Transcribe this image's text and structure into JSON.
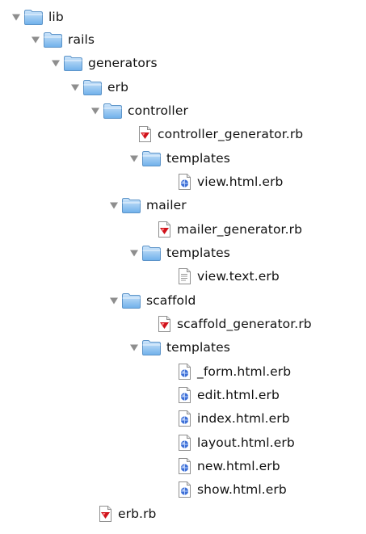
{
  "tree": {
    "nodes": [
      {
        "id": "lib",
        "label": "lib",
        "icon": "folder-icon",
        "kind": "folder",
        "expanded": true
      },
      {
        "id": "rails",
        "label": "rails",
        "icon": "folder-icon",
        "kind": "folder",
        "expanded": true
      },
      {
        "id": "generators",
        "label": "generators",
        "icon": "folder-icon",
        "kind": "folder",
        "expanded": true
      },
      {
        "id": "erb",
        "label": "erb",
        "icon": "folder-icon",
        "kind": "folder",
        "expanded": true
      },
      {
        "id": "controller",
        "label": "controller",
        "icon": "folder-icon",
        "kind": "folder",
        "expanded": true
      },
      {
        "id": "controller-generator-rb",
        "label": "controller_generator.rb",
        "icon": "ruby-file-icon",
        "kind": "ruby"
      },
      {
        "id": "controller-templates",
        "label": "templates",
        "icon": "folder-icon",
        "kind": "folder",
        "expanded": true
      },
      {
        "id": "view-html-erb",
        "label": "view.html.erb",
        "icon": "html-erb-file-icon",
        "kind": "web"
      },
      {
        "id": "mailer",
        "label": "mailer",
        "icon": "folder-icon",
        "kind": "folder",
        "expanded": true
      },
      {
        "id": "mailer-generator-rb",
        "label": "mailer_generator.rb",
        "icon": "ruby-file-icon",
        "kind": "ruby"
      },
      {
        "id": "mailer-templates",
        "label": "templates",
        "icon": "folder-icon",
        "kind": "folder",
        "expanded": true
      },
      {
        "id": "view-text-erb",
        "label": "view.text.erb",
        "icon": "text-file-icon",
        "kind": "text"
      },
      {
        "id": "scaffold",
        "label": "scaffold",
        "icon": "folder-icon",
        "kind": "folder",
        "expanded": true
      },
      {
        "id": "scaffold-generator-rb",
        "label": "scaffold_generator.rb",
        "icon": "ruby-file-icon",
        "kind": "ruby"
      },
      {
        "id": "scaffold-templates",
        "label": "templates",
        "icon": "folder-icon",
        "kind": "folder",
        "expanded": true
      },
      {
        "id": "form-html-erb",
        "label": "_form.html.erb",
        "icon": "html-erb-file-icon",
        "kind": "web"
      },
      {
        "id": "edit-html-erb",
        "label": "edit.html.erb",
        "icon": "html-erb-file-icon",
        "kind": "web"
      },
      {
        "id": "index-html-erb",
        "label": "index.html.erb",
        "icon": "html-erb-file-icon",
        "kind": "web"
      },
      {
        "id": "layout-html-erb",
        "label": "layout.html.erb",
        "icon": "html-erb-file-icon",
        "kind": "web"
      },
      {
        "id": "new-html-erb",
        "label": "new.html.erb",
        "icon": "html-erb-file-icon",
        "kind": "web"
      },
      {
        "id": "show-html-erb",
        "label": "show.html.erb",
        "icon": "html-erb-file-icon",
        "kind": "web"
      },
      {
        "id": "erb-rb",
        "label": "erb.rb",
        "icon": "ruby-file-icon",
        "kind": "ruby"
      }
    ]
  },
  "colors": {
    "folder_light": "#cfe6fb",
    "folder_dark": "#6fb0ea",
    "folder_edge": "#5b93c8",
    "triangle": "#8e8e8e",
    "ruby_red": "#d0121b",
    "label_text": "#111111"
  }
}
